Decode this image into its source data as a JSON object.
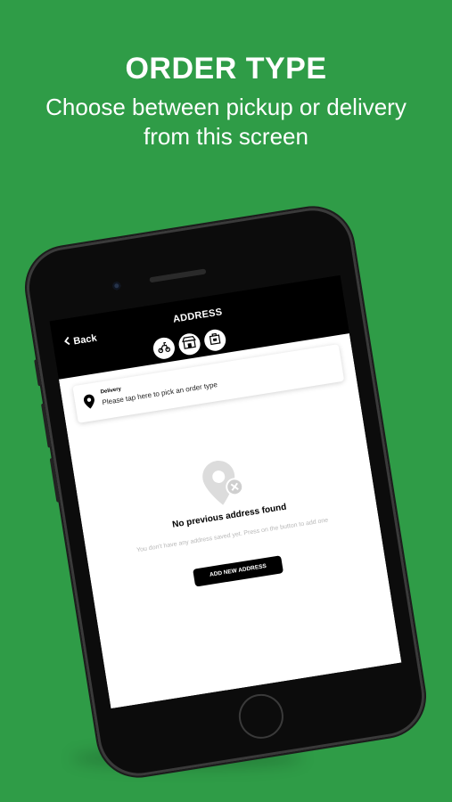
{
  "promo": {
    "headline": "ORDER TYPE",
    "subline": "Choose between pickup or delivery from this screen"
  },
  "app": {
    "header": {
      "back_label": "Back",
      "title": "ADDRESS"
    },
    "order_type_tabs": [
      {
        "icon": "scooter-icon"
      },
      {
        "icon": "store-icon"
      },
      {
        "icon": "takeaway-bag-icon"
      }
    ],
    "order_card": {
      "label": "Delivery",
      "hint": "Please tap here to pick an order type",
      "icon": "location-pin-icon"
    },
    "empty_state": {
      "icon": "location-off-icon",
      "title": "No previous address found",
      "description": "You don't have any address saved yet. Press on the button to add one",
      "button_label": "ADD NEW ADDRESS"
    }
  },
  "colors": {
    "background": "#2f9c47",
    "primary": "#000000",
    "surface": "#ffffff"
  }
}
